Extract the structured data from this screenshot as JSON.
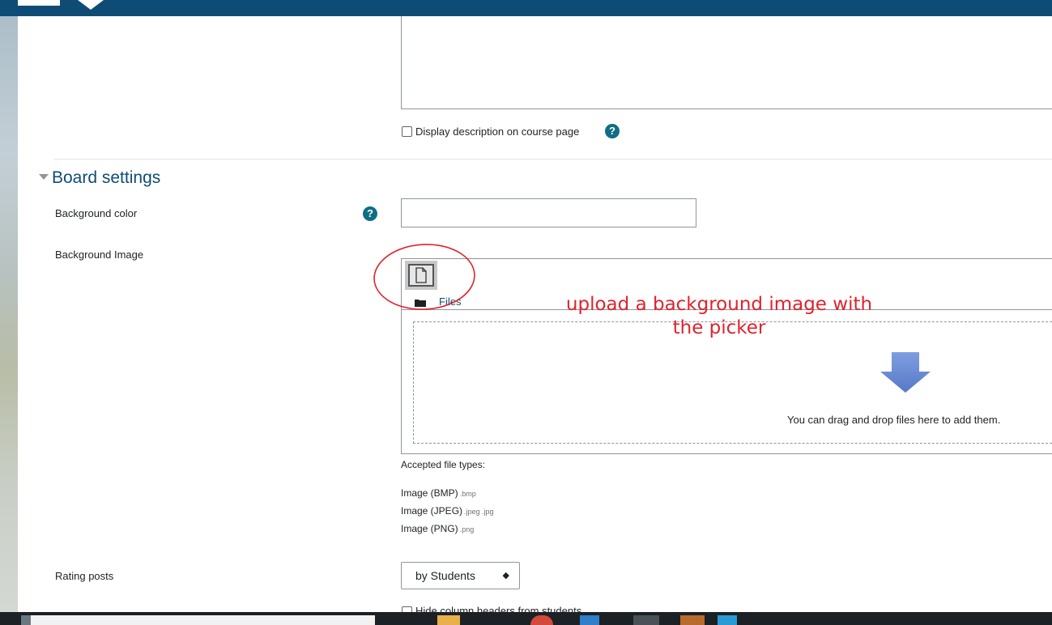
{
  "form": {
    "display_description_label": "Display description on course page",
    "section_title": "Board settings",
    "background_color_label": "Background color",
    "background_color_value": "",
    "background_image_label": "Background Image",
    "files_label": "Files",
    "drop_hint": "You can drag and drop files here to add them.",
    "accepted_label": "Accepted file types:",
    "file_types": [
      {
        "name": "Image (BMP)",
        "ext": ".bmp"
      },
      {
        "name": "Image (JPEG)",
        "ext": ".jpeg .jpg"
      },
      {
        "name": "Image (PNG)",
        "ext": ".png"
      }
    ],
    "rating_label": "Rating posts",
    "rating_value": "by Students",
    "hide_headers_label": "Hide column headers from students"
  },
  "annotation": {
    "line1": "upload a background image with",
    "line2": "the picker",
    "color": "#e0232c"
  },
  "colors": {
    "brand": "#0f4c75",
    "help": "#0f6e84",
    "arrow": "#6f8fd6"
  },
  "icons": [
    "help-icon",
    "file-picker-icon",
    "folder-icon",
    "drop-arrow-icon",
    "select-caret-icon",
    "collapse-triangle-icon"
  ]
}
